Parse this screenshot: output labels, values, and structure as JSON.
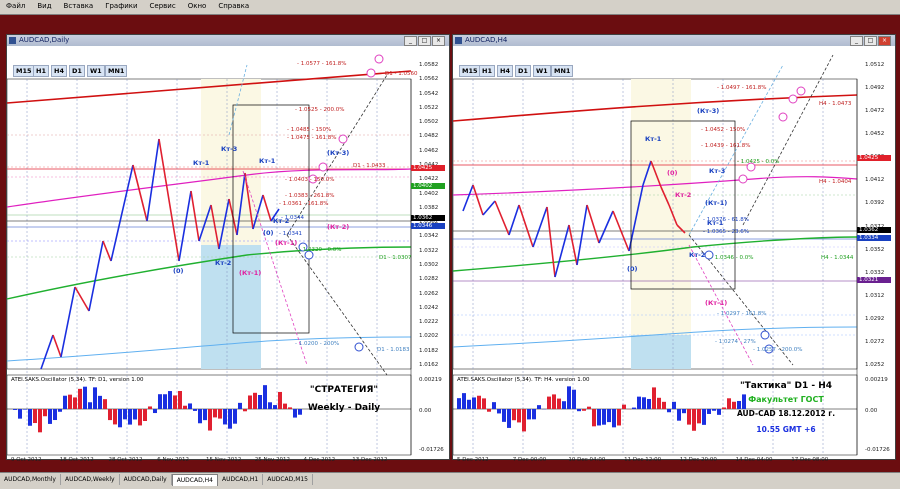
{
  "menu": [
    "Файл",
    "Вид",
    "Вставка",
    "Графики",
    "Сервис",
    "Окно",
    "Справка"
  ],
  "left": {
    "title": "AUDCAD,Daily",
    "timeframes": [
      "M15",
      "H1",
      "H4",
      "D1",
      "W1",
      "MN1"
    ],
    "price_ticks": [
      "1.0582",
      "1.0562",
      "1.0542",
      "1.0522",
      "1.0502",
      "1.0482",
      "1.0462",
      "1.0442",
      "1.0422",
      "1.0402",
      "1.0382",
      "1.0362",
      "1.0342",
      "1.0322",
      "1.0302",
      "1.0282",
      "1.0262",
      "1.0242",
      "1.0222",
      "1.0202",
      "1.0182",
      "1.0162"
    ],
    "price_marks": [
      {
        "text": "1.0425",
        "color": "#e0202a"
      },
      {
        "text": "1.0402",
        "color": "#20a020"
      },
      {
        "text": "1.0362",
        "color": "#000000"
      },
      {
        "text": "1.0346",
        "color": "#1840c0"
      }
    ],
    "level_labels": [
      "- 1.0577 - 161.8%",
      "- 1.0525 - 200.0%",
      "- 1.0485 - 150%",
      "- 1.0475 - 161.8%",
      "- 1.0403 - 150.0%",
      "- 1.0383 - 261.8%",
      "- 1.0361 - 161.8%",
      "- 1.0344",
      "- 1.0341",
      "- 1.0320 - 0.0%",
      "D1 - 1.0433",
      "D1 - 1.0307",
      "D1 - 1.0560",
      "- 1.0200 - 200%",
      "D1 - 1.0183"
    ],
    "wave_labels": [
      "Кт-1",
      "Кт-3",
      "Кт-1",
      "Кт-2",
      "(Кт-3)",
      "Кт-2",
      "(Кт-1)",
      "(0)",
      "(0)",
      "(Кт-2)",
      "(Кт-1)"
    ],
    "osc_label": "ATEI.SAKS.Oscillator (5,34). TF: D1, version 1.00",
    "osc_ticks": [
      "0.00219",
      "0.00",
      "-0.01726"
    ],
    "date_ticks": [
      "9 Oct 2012",
      "18 Oct 2012",
      "28 Oct 2012",
      "6 Nov 2012",
      "15 Nov 2012",
      "25 Nov 2012",
      "4 Dec 2012",
      "13 Dec 2012"
    ],
    "note_line1": "\"СТРАТЕГИЯ\"",
    "note_line2": "Weekly - Daily"
  },
  "right": {
    "title": "AUDCAD,H4",
    "timeframes": [
      "M15",
      "H1",
      "H4",
      "D1",
      "W1",
      "MN1"
    ],
    "price_ticks": [
      "1.0512",
      "1.0492",
      "1.0472",
      "1.0452",
      "1.0432",
      "1.0412",
      "1.0392",
      "1.0372",
      "1.0352",
      "1.0332",
      "1.0312",
      "1.0292",
      "1.0272",
      "1.0252"
    ],
    "price_marks": [
      {
        "text": "1.0425",
        "color": "#e0202a"
      },
      {
        "text": "1.0362",
        "color": "#000000"
      },
      {
        "text": "1.0334",
        "color": "#1840c0"
      },
      {
        "text": "1.0321",
        "color": "#6a2090"
      }
    ],
    "level_labels": [
      "- 1.0497 - 161.8%",
      "H4 - 1.0473",
      "- 1.0452 - 150%",
      "- 1.0439 - 161.8%",
      "- 1.0425 - 0.0%",
      "H4 - 1.0404",
      "- 1.0376 - 61.8%",
      "- 1.0365 - 23.6%",
      "- 1.0346 - 0.0%",
      "H4 - 1.0344",
      "- 1.0297 - 161.8%",
      "- 1.0274 - 27%",
      "- 1.0257 - 200.0%"
    ],
    "wave_labels": [
      "Кт-1",
      "(Кт-3)",
      "(0)",
      "Кт-2",
      "(Кт-1)",
      "Кт-2",
      "(0)",
      "(Кт-1)",
      "Кт-1",
      "Кт-3"
    ],
    "osc_label": "ATEI.SAKS.Oscillator (5,34). TF: H4. version 1.00",
    "osc_ticks": [
      "0.00219",
      "0.00",
      "-0.01726"
    ],
    "date_ticks": [
      "5 Dec 2012",
      "7 Dec 00:00",
      "10 Dec 04:00",
      "11 Dec 12:00",
      "12 Dec 20:00",
      "14 Dec 04:00",
      "17 Dec 08:00"
    ],
    "note_line1": "\"Тактика\"  D1 - H4",
    "note_line2": "Факультет ГОСТ",
    "note_line3": "AUD-CAD  18.12.2012  г.",
    "note_line4": "10.55   GMT +6"
  },
  "tabs": [
    "AUDCAD,Monthly",
    "AUDCAD,Weekly",
    "AUDCAD,Daily",
    "AUDCAD,H4",
    "AUDCAD,H1",
    "AUDCAD,M15"
  ],
  "active_tab": "AUDCAD,H4",
  "colors": {
    "bg": "#6b0d10",
    "up": "#1a2fe0",
    "down": "#e02030",
    "ma_red": "#d01010",
    "ma_green": "#20b030",
    "ma_magenta": "#e020c0",
    "ma_blue": "#60b0f0"
  }
}
